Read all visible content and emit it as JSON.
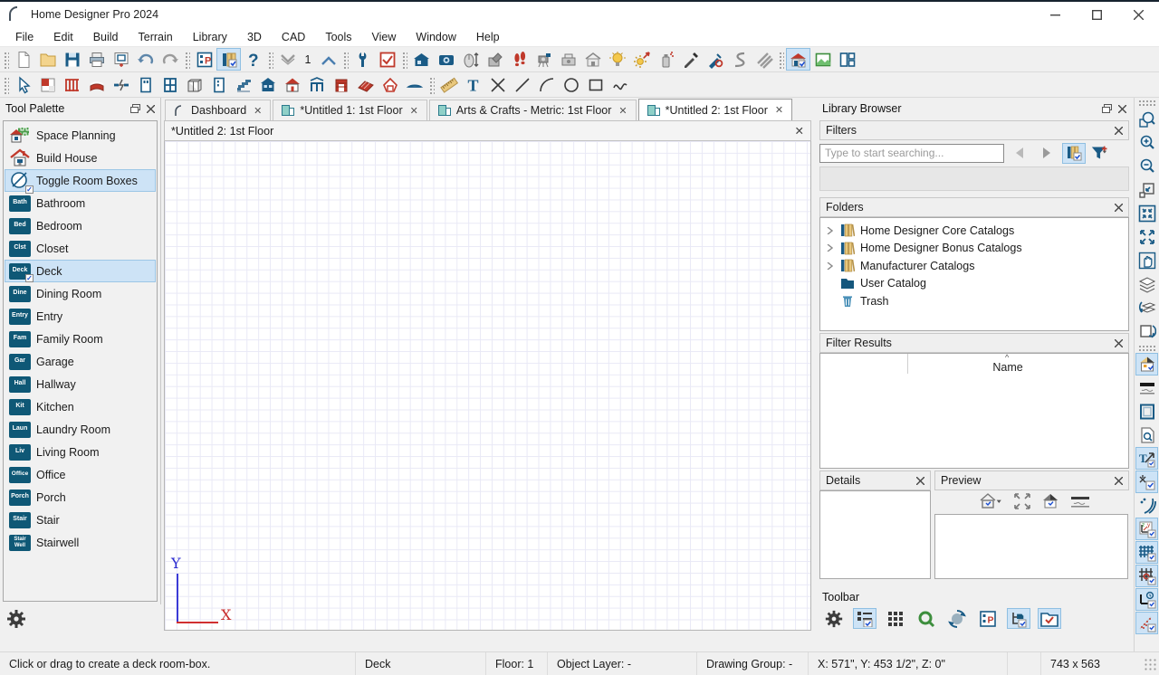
{
  "window": {
    "title": "Home Designer Pro 2024"
  },
  "menu": {
    "items": [
      "File",
      "Edit",
      "Build",
      "Terrain",
      "Library",
      "3D",
      "CAD",
      "Tools",
      "View",
      "Window",
      "Help"
    ]
  },
  "toolbar": {
    "floor_indicator": "1"
  },
  "icons": {
    "glyphs": {
      "help": "?",
      "project_p": "P",
      "text_tool": "T",
      "close": "×",
      "float": "◱",
      "sort_caret": "^",
      "expander": "›",
      "caret_down": "▾"
    }
  },
  "tool_palette": {
    "title": "Tool Palette",
    "items": [
      {
        "label": "Space Planning",
        "badge": ""
      },
      {
        "label": "Build House",
        "badge": ""
      },
      {
        "label": "Toggle Room Boxes",
        "badge": ""
      },
      {
        "label": "Bathroom",
        "badge": "Bath"
      },
      {
        "label": "Bedroom",
        "badge": "Bed"
      },
      {
        "label": "Closet",
        "badge": "Clst"
      },
      {
        "label": "Deck",
        "badge": "Deck"
      },
      {
        "label": "Dining Room",
        "badge": "Dine"
      },
      {
        "label": "Entry",
        "badge": "Entry"
      },
      {
        "label": "Family Room",
        "badge": "Fam"
      },
      {
        "label": "Garage",
        "badge": "Gar"
      },
      {
        "label": "Hallway",
        "badge": "Hall"
      },
      {
        "label": "Kitchen",
        "badge": "Kit"
      },
      {
        "label": "Laundry Room",
        "badge": "Laun"
      },
      {
        "label": "Living Room",
        "badge": "Liv"
      },
      {
        "label": "Office",
        "badge": "Office"
      },
      {
        "label": "Porch",
        "badge": "Porch"
      },
      {
        "label": "Stair",
        "badge": "Stair"
      },
      {
        "label": "Stairwell",
        "badge": "Stair Well"
      }
    ]
  },
  "tabs": [
    {
      "label": "Dashboard"
    },
    {
      "label": "*Untitled 1: 1st Floor"
    },
    {
      "label": "Arts & Crafts - Metric: 1st Floor"
    },
    {
      "label": "*Untitled 2: 1st Floor"
    }
  ],
  "document": {
    "title": "*Untitled 2: 1st Floor",
    "axis_x": "X",
    "axis_y": "Y"
  },
  "library": {
    "title": "Library Browser",
    "filters": {
      "title": "Filters",
      "search_placeholder": "Type to start searching..."
    },
    "folders": {
      "title": "Folders",
      "items": [
        {
          "label": "Home Designer Core Catalogs"
        },
        {
          "label": "Home Designer Bonus Catalogs"
        },
        {
          "label": "Manufacturer Catalogs"
        },
        {
          "label": "User Catalog"
        },
        {
          "label": "Trash"
        }
      ]
    },
    "filter_results": {
      "title": "Filter Results",
      "column": "Name"
    },
    "details": {
      "title": "Details"
    },
    "preview": {
      "title": "Preview"
    },
    "toolbar_panel": {
      "title": "Toolbar"
    }
  },
  "status_bar": {
    "hint": "Click or drag to create a deck room-box.",
    "tool": "Deck",
    "floor": "Floor: 1",
    "object_layer": "Object Layer: -",
    "drawing_group": "Drawing Group: -",
    "coordinates": "X: 571\", Y: 453 1/2\", Z: 0\"",
    "view_size": "743 x 563"
  },
  "colors": {
    "selection_bg": "#cde3f6",
    "selection_border": "#8fbfe2",
    "badge_bg": "#0f5876",
    "icon_navy": "#1a5b86",
    "icon_red": "#b24434",
    "grid_line": "#e9e9f6",
    "axis_x": "#c82a2a",
    "axis_y": "#2b2bd0"
  }
}
